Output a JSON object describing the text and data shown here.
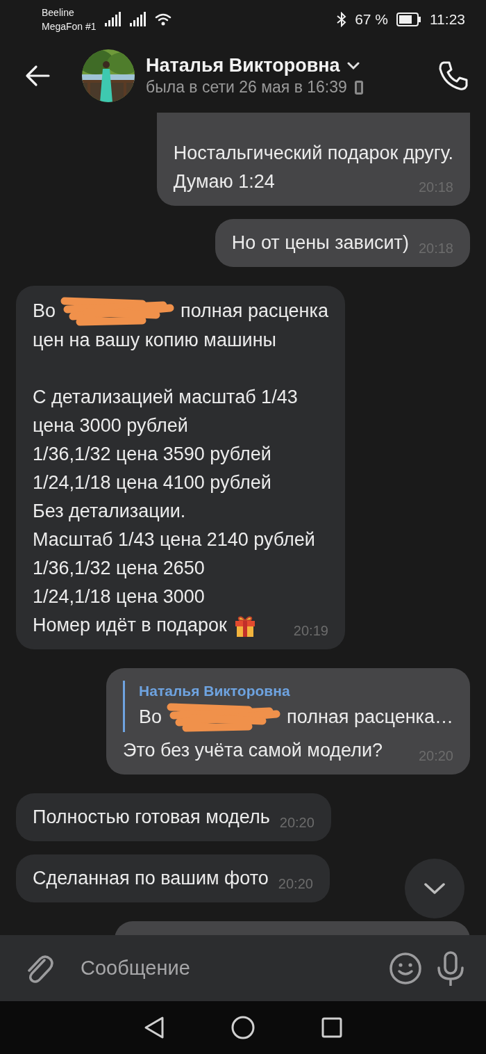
{
  "status_bar": {
    "carriers": [
      "Beeline",
      "MegaFon #1"
    ],
    "battery_percent": "67 %",
    "time": "11:23"
  },
  "header": {
    "name": "Наталья Викторовна",
    "last_seen": "была в сети 26 мая в 16:39"
  },
  "messages": [
    {
      "kind": "text",
      "outgoing": true,
      "paragraphs": [
        [
          "Ностальгический подарок другу.",
          "Думаю 1:24"
        ]
      ],
      "time": "20:18"
    },
    {
      "kind": "text",
      "outgoing": true,
      "paragraphs": [
        [
          "Но от цены зависит)"
        ]
      ],
      "time": "20:18"
    },
    {
      "kind": "text",
      "outgoing": false,
      "paragraphs": [
        [
          [
            "Во",
            "полная расценка"
          ],
          "цен на вашу копию машины"
        ],
        [
          "С детализацией масштаб 1/43",
          "цена 3000 рублей",
          "1/36,1/32 цена 3590 рублей",
          "1/24,1/18 цена 4100 рублей",
          "Без детализации.",
          "Масштаб 1/43 цена 2140 рублей",
          "1/36,1/32 цена 2650",
          "1/24,1/18 цена 3000",
          "Номер идёт в подарок"
        ]
      ],
      "gift_icon": true,
      "time": "20:19"
    },
    {
      "kind": "reply",
      "outgoing": true,
      "quote": {
        "author": "Наталья Викторовна",
        "parts": [
          "Во",
          "полная расценка…"
        ]
      },
      "paragraphs": [
        [
          "Это без учёта самой модели?"
        ]
      ],
      "time": "20:20"
    },
    {
      "kind": "text",
      "outgoing": false,
      "paragraphs": [
        [
          "Полностью готовая модель"
        ]
      ],
      "time": "20:20"
    },
    {
      "kind": "text",
      "outgoing": false,
      "paragraphs": [
        [
          "Сделанная по вашим фото"
        ]
      ],
      "time": "20:20"
    },
    {
      "kind": "cut",
      "outgoing": true
    }
  ],
  "composer": {
    "placeholder": "Сообщение"
  }
}
